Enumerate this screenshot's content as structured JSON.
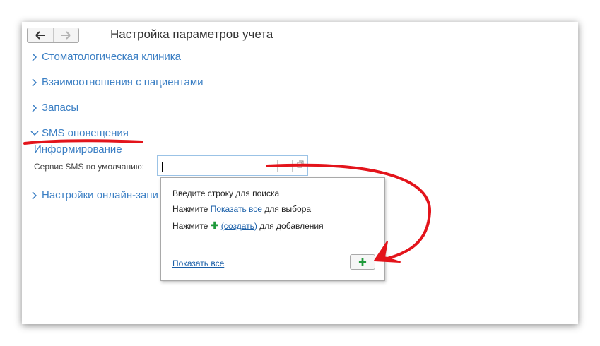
{
  "header": {
    "title": "Настройка параметров учета",
    "back_icon": "arrow-left-icon",
    "forward_icon": "arrow-right-icon"
  },
  "sections": [
    {
      "label": "Стоматологическая клиника",
      "expanded": false
    },
    {
      "label": "Взаимоотношения с пациентами",
      "expanded": false
    },
    {
      "label": "Запасы",
      "expanded": false
    },
    {
      "label": "SMS оповещения",
      "expanded": true
    },
    {
      "label": "Настройки онлайн-запи",
      "expanded": false
    }
  ],
  "sms": {
    "group_title": "Информирование",
    "field_label": "Сервис SMS по умолчанию:",
    "field_value": ""
  },
  "popup": {
    "line1": "Введите строку для поиска",
    "line2_prefix": "Нажмите",
    "line2_link": "Показать все",
    "line2_suffix": "для выбора",
    "line3_prefix": "Нажмите",
    "line3_link": "(создать)",
    "line3_suffix": "для добавления",
    "show_all_link": "Показать все",
    "add_icon": "plus-icon"
  },
  "colors": {
    "link": "#3b7fc4",
    "annotation": "#e3141b",
    "plus": "#1e9a3a"
  }
}
